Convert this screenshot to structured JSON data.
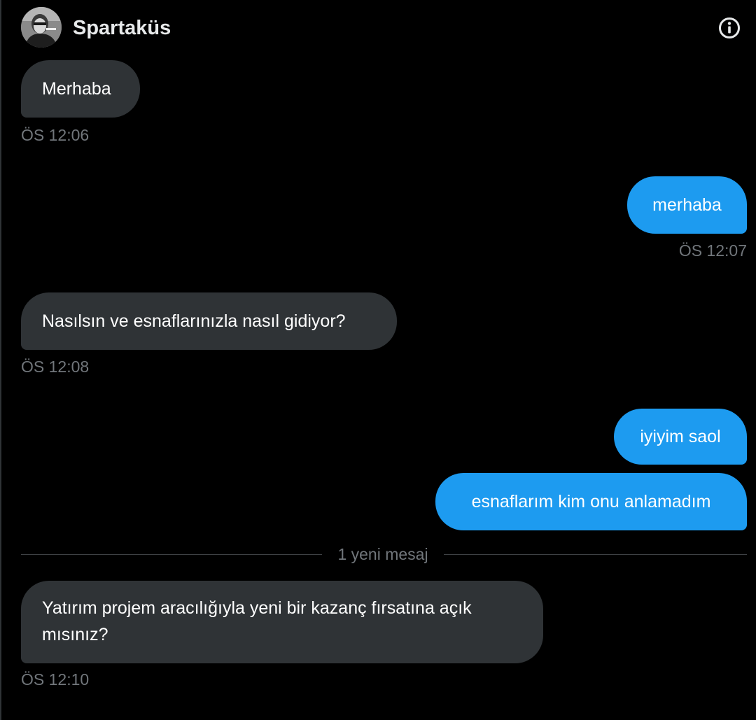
{
  "header": {
    "contact_name": "Spartaküs",
    "avatar_icon": "avatar-photo",
    "info_icon": "info-circle-icon"
  },
  "messages": [
    {
      "direction": "incoming",
      "text": "Merhaba",
      "time": "ÖS 12:06"
    },
    {
      "direction": "outgoing",
      "text": "merhaba",
      "time": "ÖS 12:07"
    },
    {
      "direction": "incoming",
      "text": "Nasılsın ve esnaflarınızla nasıl gidiyor?",
      "time": "ÖS 12:08"
    },
    {
      "direction": "outgoing",
      "text": "iyiyim saol"
    },
    {
      "direction": "outgoing",
      "text": "esnaflarım kim onu anlamadım"
    },
    {
      "direction": "incoming",
      "text": "Yatırım projem aracılığıyla yeni bir kazanç fırsatına açık mısınız?",
      "time": "ÖS 12:10"
    }
  ],
  "divider": {
    "label": "1 yeni mesaj"
  },
  "colors": {
    "background": "#000000",
    "incoming_bubble": "#2f3336",
    "outgoing_bubble": "#1d9bf0",
    "timestamp": "#71767b"
  }
}
